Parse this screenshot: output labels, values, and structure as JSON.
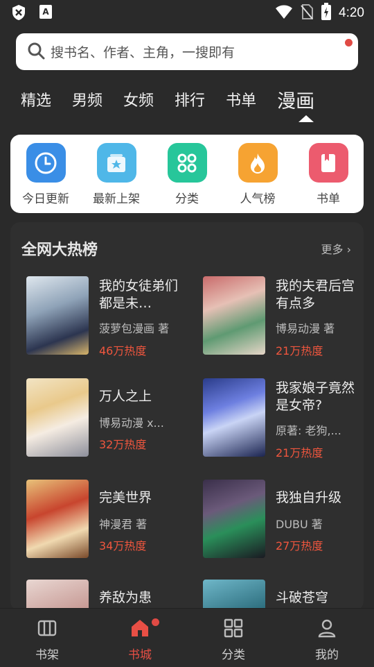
{
  "status_bar": {
    "time": "4:20"
  },
  "search": {
    "placeholder": "搜书名、作者、主角，一搜即有"
  },
  "tabs": [
    {
      "label": "精选"
    },
    {
      "label": "男频"
    },
    {
      "label": "女频"
    },
    {
      "label": "排行"
    },
    {
      "label": "书单"
    },
    {
      "label": "漫画"
    }
  ],
  "quick": [
    {
      "label": "今日更新",
      "icon": "clock-icon",
      "color": "#3a8ee6"
    },
    {
      "label": "最新上架",
      "icon": "star-box-icon",
      "color": "#4fb7e8"
    },
    {
      "label": "分类",
      "icon": "grid-icon",
      "color": "#27c69a"
    },
    {
      "label": "人气榜",
      "icon": "flame-icon",
      "color": "#f6a332"
    },
    {
      "label": "书单",
      "icon": "book-icon",
      "color": "#ec5b6e"
    }
  ],
  "hot": {
    "title": "全网大热榜",
    "more": "更多",
    "items": [
      {
        "title": "我的女徒弟们都是未…",
        "author": "菠萝包漫画 著",
        "heat": "46万热度"
      },
      {
        "title": "我的夫君后宫有点多",
        "author": "博易动漫 著",
        "heat": "21万热度"
      },
      {
        "title": "万人之上",
        "author": "博易动漫 x...",
        "heat": "32万热度"
      },
      {
        "title": "我家娘子竟然是女帝?",
        "author": "原著: 老狗,...",
        "heat": "21万热度"
      },
      {
        "title": "完美世界",
        "author": "神漫君 著",
        "heat": "34万热度"
      },
      {
        "title": "我独自升级",
        "author": "DUBU 著",
        "heat": "27万热度"
      },
      {
        "title": "养敌为患",
        "author": "",
        "heat": ""
      },
      {
        "title": "斗破苍穹",
        "author": "",
        "heat": ""
      }
    ]
  },
  "bottom_nav": [
    {
      "label": "书架",
      "icon": "bookshelf-icon"
    },
    {
      "label": "书城",
      "icon": "store-icon"
    },
    {
      "label": "分类",
      "icon": "category-icon"
    },
    {
      "label": "我的",
      "icon": "profile-icon"
    }
  ]
}
